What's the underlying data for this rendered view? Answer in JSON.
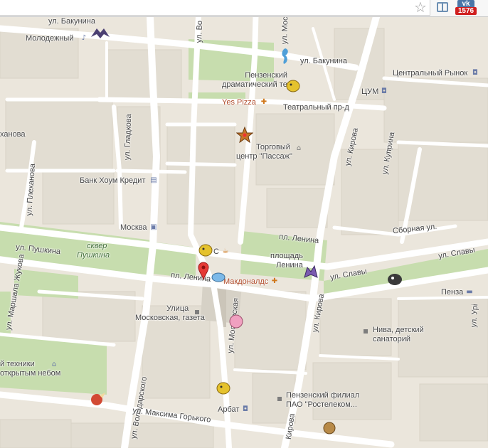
{
  "browser": {
    "star_glyph": "☆",
    "vk_logo": "vk",
    "vk_count": "1576"
  },
  "map": {
    "colors": {
      "background": "#ebe6dc",
      "road": "#ffffff",
      "block": "#e0dbd0",
      "park": "#c4ddaa",
      "pedestrian": "#d7d2c8"
    },
    "streets": {
      "bakunina_west": "ул. Бакунина",
      "bakunina_east": "ул. Бакунина",
      "teatralny": "Театральный пр-д",
      "gladkova": "ул. Гладкова",
      "plekhanova": "ул. Плеханова",
      "anova": "ханова",
      "pushkina": "ул. Пушкина",
      "marshala_zhukova": "ул. Маршала Жукова",
      "lenina_square_top": "пл. Ленина",
      "lenina_square_left": "пл. Ленина",
      "slavy_top": "ул. Славы",
      "slavy_bottom": "ул. Славы",
      "kirova_top": "ул. Кирова",
      "kirova_mid": "ул. Кирова",
      "kirova_bottom": "Кирова",
      "kuprina": "ул. Куприна",
      "sbornaya": "Сборная ул.",
      "volodarskogo": "ул. Володарского",
      "moskovskaya_top": "ул. Московская",
      "moskovskaya_mid": "ул. Московская",
      "maksima_gorkogo": "ул. Максима Горького",
      "uritskogo": "ул. Урі",
      "ve_fragment": "ул. Во"
    },
    "places": {
      "molodezhny": "Молодежный",
      "drama_theatre_1": "Пензенский",
      "drama_theatre_2": "драматический театр",
      "yes_pizza": "Yes Pizza",
      "tsum": "ЦУМ",
      "central_market": "Центральный Рынок",
      "passage_1": "Торговый",
      "passage_2": "центр \"Пассаж\"",
      "bank": "Банк Хоум Кредит",
      "moskva": "Москва",
      "skver_1": "сквер",
      "skver_2": "Пушкина",
      "cafe_c": "С",
      "ploshchad_1": "площадь",
      "ploshchad_2": "Ленина",
      "mcdonalds": "Макдоналдс",
      "ulitsa_1": "Улица",
      "ulitsa_2": "Московская, газета",
      "niva_1": "Нива, детский",
      "niva_2": "санаторий",
      "penza": "Пенза",
      "technika_1": "й техники",
      "technika_2": "открытым небом",
      "rostelecom_1": "Пензенский филиал",
      "rostelecom_2": "ПАО \"Ростелеком...",
      "arbat": "Арбат"
    },
    "icons": {
      "music": "♪",
      "theatre": "♟",
      "food": "🍴",
      "shop": "🛍",
      "bank": "🏦",
      "metro": "Ⓜ",
      "cafe": "☕",
      "hotel": "🛏",
      "museum": "🏛",
      "star": "★"
    }
  }
}
